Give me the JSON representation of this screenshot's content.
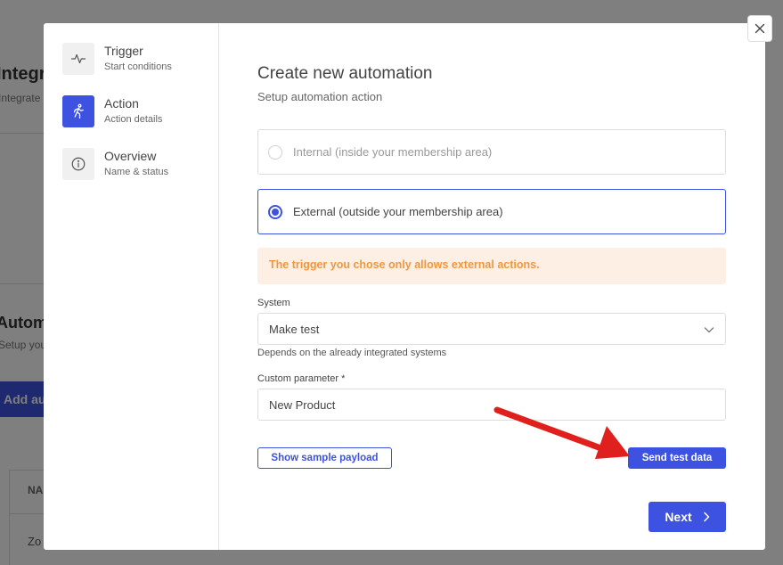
{
  "background": {
    "title1": "Integrat",
    "sub1": "Integrate se",
    "title2": "Automa",
    "sub2": "Setup your",
    "add_button": "Add au",
    "table_header": "NA",
    "table_cell": "Zo"
  },
  "steps": [
    {
      "title": "Trigger",
      "subtitle": "Start conditions",
      "icon": "activity-icon",
      "active": false
    },
    {
      "title": "Action",
      "subtitle": "Action details",
      "icon": "running-person-icon",
      "active": true
    },
    {
      "title": "Overview",
      "subtitle": "Name & status",
      "icon": "info-icon",
      "active": false
    }
  ],
  "modal": {
    "title": "Create new automation",
    "subtitle": "Setup automation action",
    "options": [
      {
        "label": "Internal (inside your membership area)",
        "selected": false
      },
      {
        "label": "External (outside your membership area)",
        "selected": true
      }
    ],
    "alert": "The trigger you chose only allows external actions.",
    "system": {
      "label": "System",
      "value": "Make test",
      "helper": "Depends on the already integrated systems"
    },
    "custom_parameter": {
      "label": "Custom parameter *",
      "value": "New Product"
    },
    "show_payload_label": "Show sample payload",
    "send_test_label": "Send test data",
    "next_label": "Next"
  },
  "colors": {
    "accent": "#3d52e0",
    "alert_bg": "#fdefe3",
    "alert_text": "#f0973e",
    "annotation_arrow": "#e0201c"
  }
}
